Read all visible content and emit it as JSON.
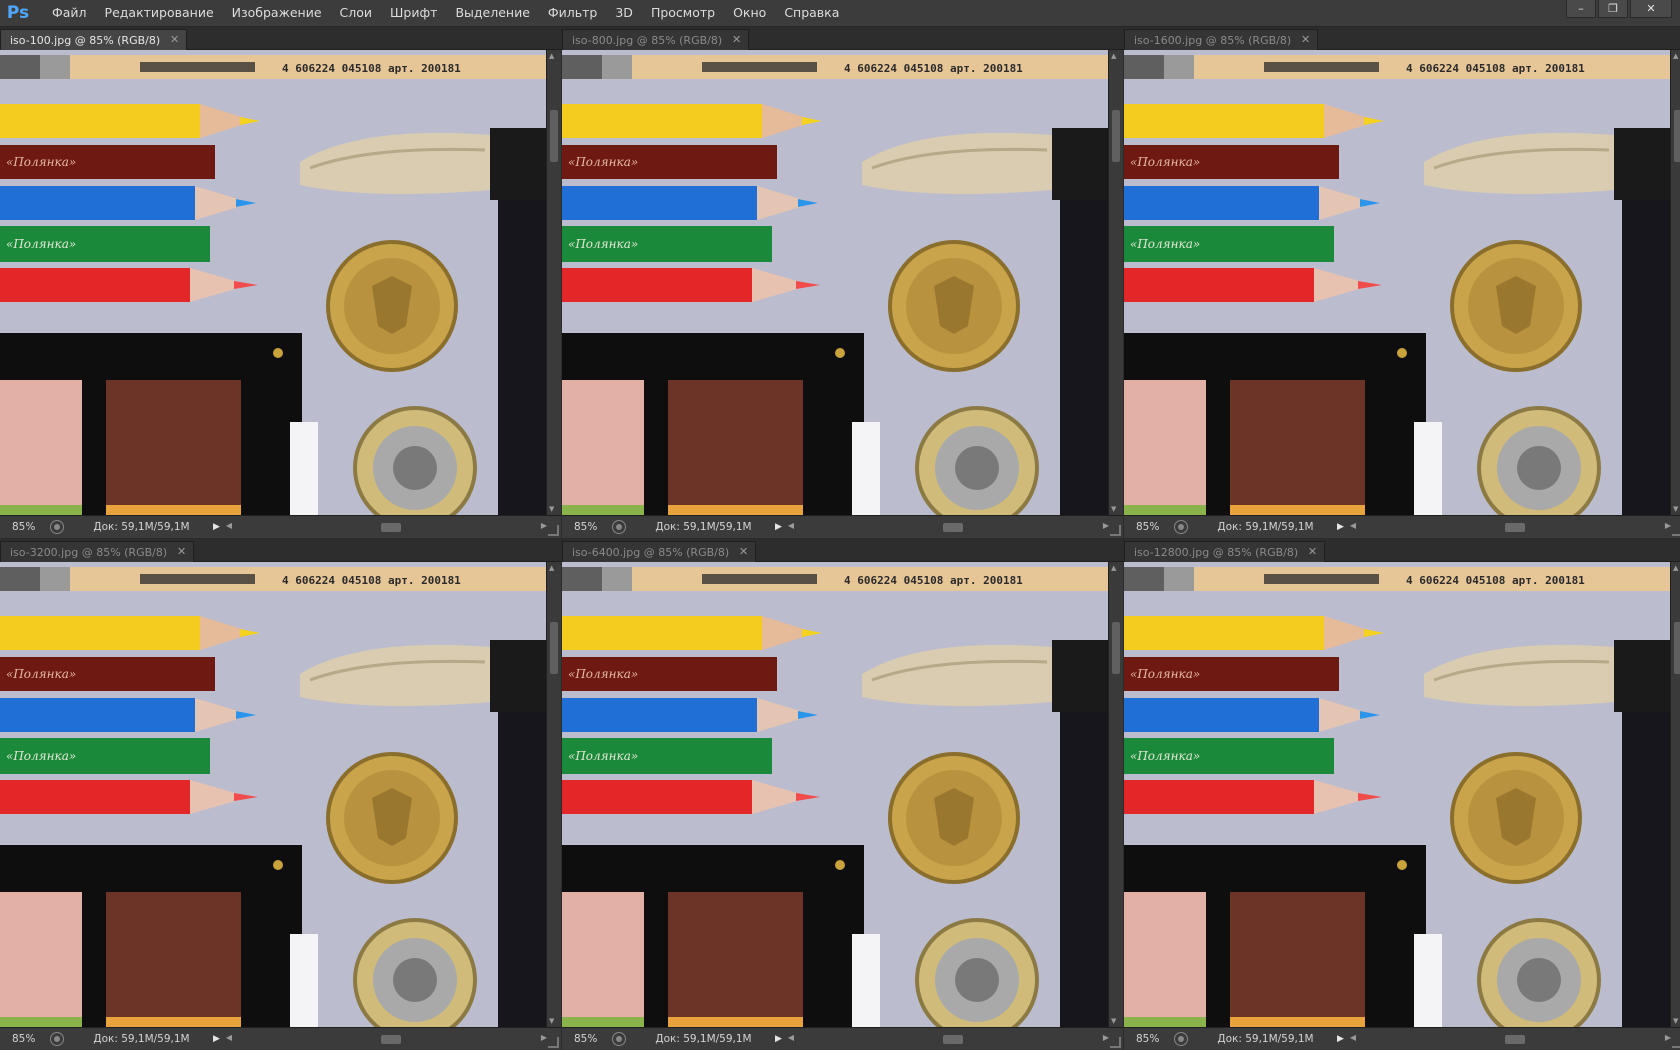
{
  "app": {
    "logo": "Ps",
    "menu": [
      "Файл",
      "Редактирование",
      "Изображение",
      "Слои",
      "Шрифт",
      "Выделение",
      "Фильтр",
      "3D",
      "Просмотр",
      "Окно",
      "Справка"
    ],
    "window_controls": {
      "minimize": "–",
      "restore": "❐",
      "close": "✕"
    }
  },
  "documents": [
    {
      "tab": "iso-100.jpg @ 85% (RGB/8)",
      "zoom": "85%",
      "doc": "Док: 59,1M/59,1M",
      "active": true
    },
    {
      "tab": "iso-800.jpg @ 85% (RGB/8)",
      "zoom": "85%",
      "doc": "Док: 59,1M/59,1M",
      "active": false
    },
    {
      "tab": "iso-1600.jpg @ 85% (RGB/8)",
      "zoom": "85%",
      "doc": "Док: 59,1M/59,1M",
      "active": false
    },
    {
      "tab": "iso-3200.jpg @ 85% (RGB/8)",
      "zoom": "85%",
      "doc": "Док: 59,1M/59,1M",
      "active": false
    },
    {
      "tab": "iso-6400.jpg @ 85% (RGB/8)",
      "zoom": "85%",
      "doc": "Док: 59,1M/59,1M",
      "active": false
    },
    {
      "tab": "iso-12800.jpg @ 85% (RGB/8)",
      "zoom": "85%",
      "doc": "Док: 59,1M/59,1M",
      "active": false
    }
  ],
  "photo": {
    "pencil_barcode_text": "4 606224 045108 арт. 200181",
    "pencil_brand_text": "«Полянка»",
    "colors": {
      "background": "#bcbccf",
      "yellow": "#f3cc1f",
      "brown": "#6e1a12",
      "blue": "#1f6fd6",
      "green": "#1a8a3a",
      "red": "#e32627",
      "pink_swatch": "#e3b0a6",
      "brown_swatch": "#6b3427",
      "coin_gold": "#c9a44a"
    }
  }
}
